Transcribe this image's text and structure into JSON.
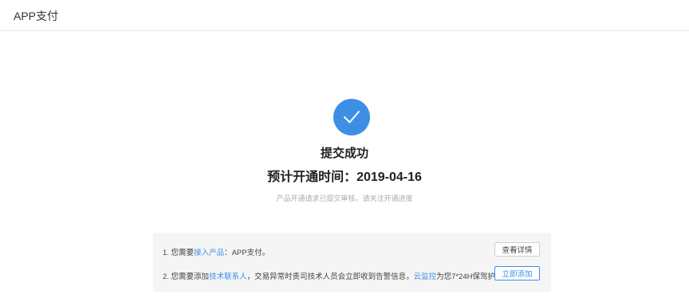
{
  "header": {
    "title": "APP支付"
  },
  "status": {
    "icon": "check-icon",
    "title": "提交成功",
    "subtitle": "预计开通时间：2019-04-16",
    "hint": "产品开通请求已提交审核，请关注开通进度"
  },
  "info": {
    "row1": {
      "prefix": "1. 您需要",
      "link": "接入产品",
      "suffix": "：APP支付。",
      "button": "查看详情"
    },
    "row2": {
      "prefix": "2. 您需要添加",
      "link1": "技术联系人",
      "middle": "，交易异常时贵司技术人员会立即收到告警信息，",
      "link2": "云监控",
      "suffix": "为您7*24H保驾护航。",
      "button": "立即添加"
    }
  },
  "colors": {
    "accent": "#3d8fe6",
    "panel": "#f5f5f5"
  }
}
